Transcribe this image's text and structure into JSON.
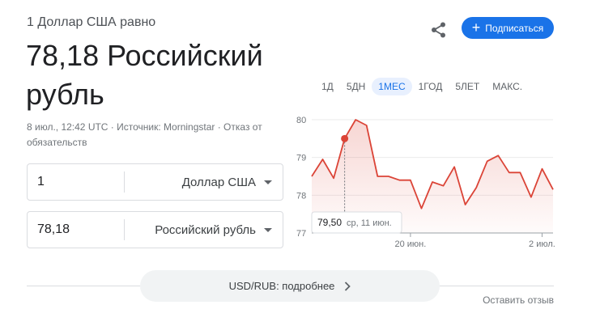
{
  "header": {
    "subtitle": "1 Доллар США равно",
    "big_value": "78,18 Российский рубль",
    "meta": "8 июл., 12:42 UTC · Источник: Morningstar · Отказ от обязательств",
    "share_icon": "share-icon",
    "follow_label": "Подписаться"
  },
  "converter": {
    "from": {
      "amount": "1",
      "currency": "Доллар США"
    },
    "to": {
      "amount": "78,18",
      "currency": "Российский рубль"
    }
  },
  "ranges": [
    {
      "label": "1Д",
      "active": false
    },
    {
      "label": "5ДН",
      "active": false
    },
    {
      "label": "1МЕС",
      "active": true
    },
    {
      "label": "1ГОД",
      "active": false
    },
    {
      "label": "5ЛЕТ",
      "active": false
    },
    {
      "label": "МАКС.",
      "active": false
    }
  ],
  "chart_data": {
    "type": "line",
    "ylim": [
      77,
      80
    ],
    "yticks": [
      "80",
      "79",
      "78",
      "77"
    ],
    "xticks": [
      {
        "label": "20 июн.",
        "x": 9
      },
      {
        "label": "2 июл.",
        "x": 21
      }
    ],
    "y": [
      78.5,
      78.95,
      78.45,
      79.5,
      80.0,
      79.85,
      78.5,
      78.5,
      78.4,
      78.4,
      77.65,
      78.35,
      78.25,
      78.75,
      77.75,
      78.2,
      78.9,
      79.05,
      78.6,
      78.6,
      77.95,
      78.7,
      78.15
    ],
    "color": "#db4437",
    "tooltip": {
      "value": "79,50",
      "date": "ср, 11 июн.",
      "index": 3
    }
  },
  "footer": {
    "more_label": "USD/RUB: подробнее",
    "feedback_label": "Оставить отзыв"
  }
}
